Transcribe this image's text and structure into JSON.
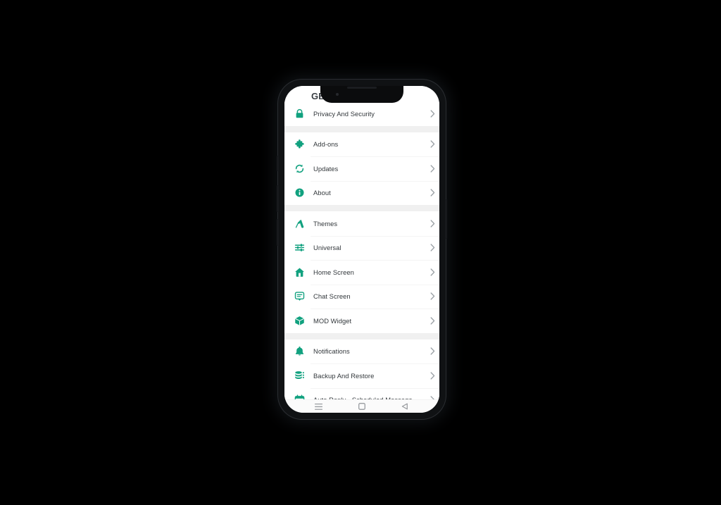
{
  "app": {
    "title": "GBW",
    "accent_color": "#11a17f",
    "label_color": "#32373b",
    "screen_background": "#ffffff",
    "section_gap_color": "#f0f0f0"
  },
  "settings": {
    "sections": [
      {
        "items": [
          {
            "label": "Privacy And Security",
            "icon": "lock-icon",
            "chevron": "chevron-right-icon"
          }
        ]
      },
      {
        "items": [
          {
            "label": "Add-ons",
            "icon": "puzzle-piece-icon",
            "chevron": "chevron-right-icon"
          },
          {
            "label": "Updates",
            "icon": "refresh-icon",
            "chevron": "chevron-right-icon"
          },
          {
            "label": "About",
            "icon": "info-icon",
            "chevron": "chevron-right-icon"
          }
        ]
      },
      {
        "items": [
          {
            "label": "Themes",
            "icon": "paint-roller-icon",
            "chevron": "chevron-right-icon"
          },
          {
            "label": "Universal",
            "icon": "sliders-icon",
            "chevron": "chevron-right-icon"
          },
          {
            "label": "Home Screen",
            "icon": "home-icon",
            "chevron": "chevron-right-icon"
          },
          {
            "label": "Chat Screen",
            "icon": "chat-bubble-icon",
            "chevron": "chevron-right-icon"
          },
          {
            "label": "MOD Widget",
            "icon": "cube-icon",
            "chevron": "chevron-right-icon"
          }
        ]
      },
      {
        "items": [
          {
            "label": "Notifications",
            "icon": "bell-icon",
            "chevron": "chevron-right-icon"
          },
          {
            "label": "Backup And Restore",
            "icon": "database-icon",
            "chevron": "chevron-right-icon"
          },
          {
            "label": "Auto Reply - Scheduled Message",
            "icon": "calendar-icon",
            "chevron": "chevron-right-icon"
          }
        ]
      }
    ]
  },
  "navbar": {
    "recents_label": "recents-icon",
    "home_label": "home-square-icon",
    "back_label": "back-triangle-icon"
  }
}
